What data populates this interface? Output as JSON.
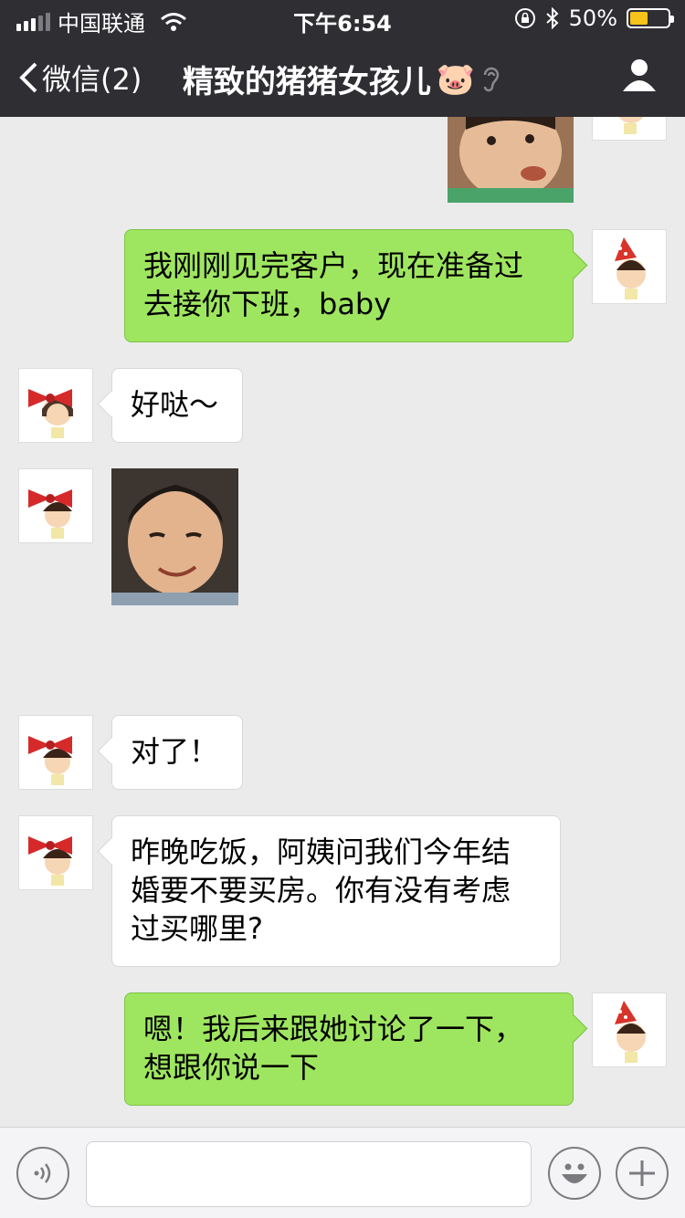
{
  "status_bar": {
    "carrier": "中国联通",
    "time": "下午6:54",
    "battery_percent": "50%",
    "battery_level": 0.5
  },
  "nav": {
    "back_label": "微信(2)",
    "title": "精致的猪猪女孩儿",
    "title_emoji": "🐷"
  },
  "messages": [
    {
      "side": "right",
      "type": "image",
      "subject": "baby-photo"
    },
    {
      "side": "right",
      "type": "text",
      "lines": [
        "我刚刚见完客户，现在准备过",
        "去接你下班，baby"
      ]
    },
    {
      "side": "left",
      "type": "text",
      "lines": [
        "好哒～"
      ]
    },
    {
      "side": "left",
      "type": "image",
      "subject": "smiling-boy-photo"
    },
    {
      "side": "left",
      "type": "text",
      "lines": [
        "对了！"
      ]
    },
    {
      "side": "left",
      "type": "text",
      "lines": [
        "昨晚吃饭，阿姨问我们今年结",
        "婚要不要买房。你有没有考虑",
        "过买哪里?"
      ]
    },
    {
      "side": "right",
      "type": "text",
      "lines": [
        "嗯！我后来跟她讨论了一下，",
        "想跟你说一下"
      ]
    }
  ],
  "input_bar": {
    "voice_icon": "voice-icon",
    "emoji_icon": "emoji-icon",
    "plus_icon": "plus-icon",
    "text_value": ""
  },
  "colors": {
    "header_bg": "#2e2e33",
    "chat_bg": "#ebebeb",
    "sent_bubble": "#9fe660",
    "received_bubble": "#ffffff"
  }
}
